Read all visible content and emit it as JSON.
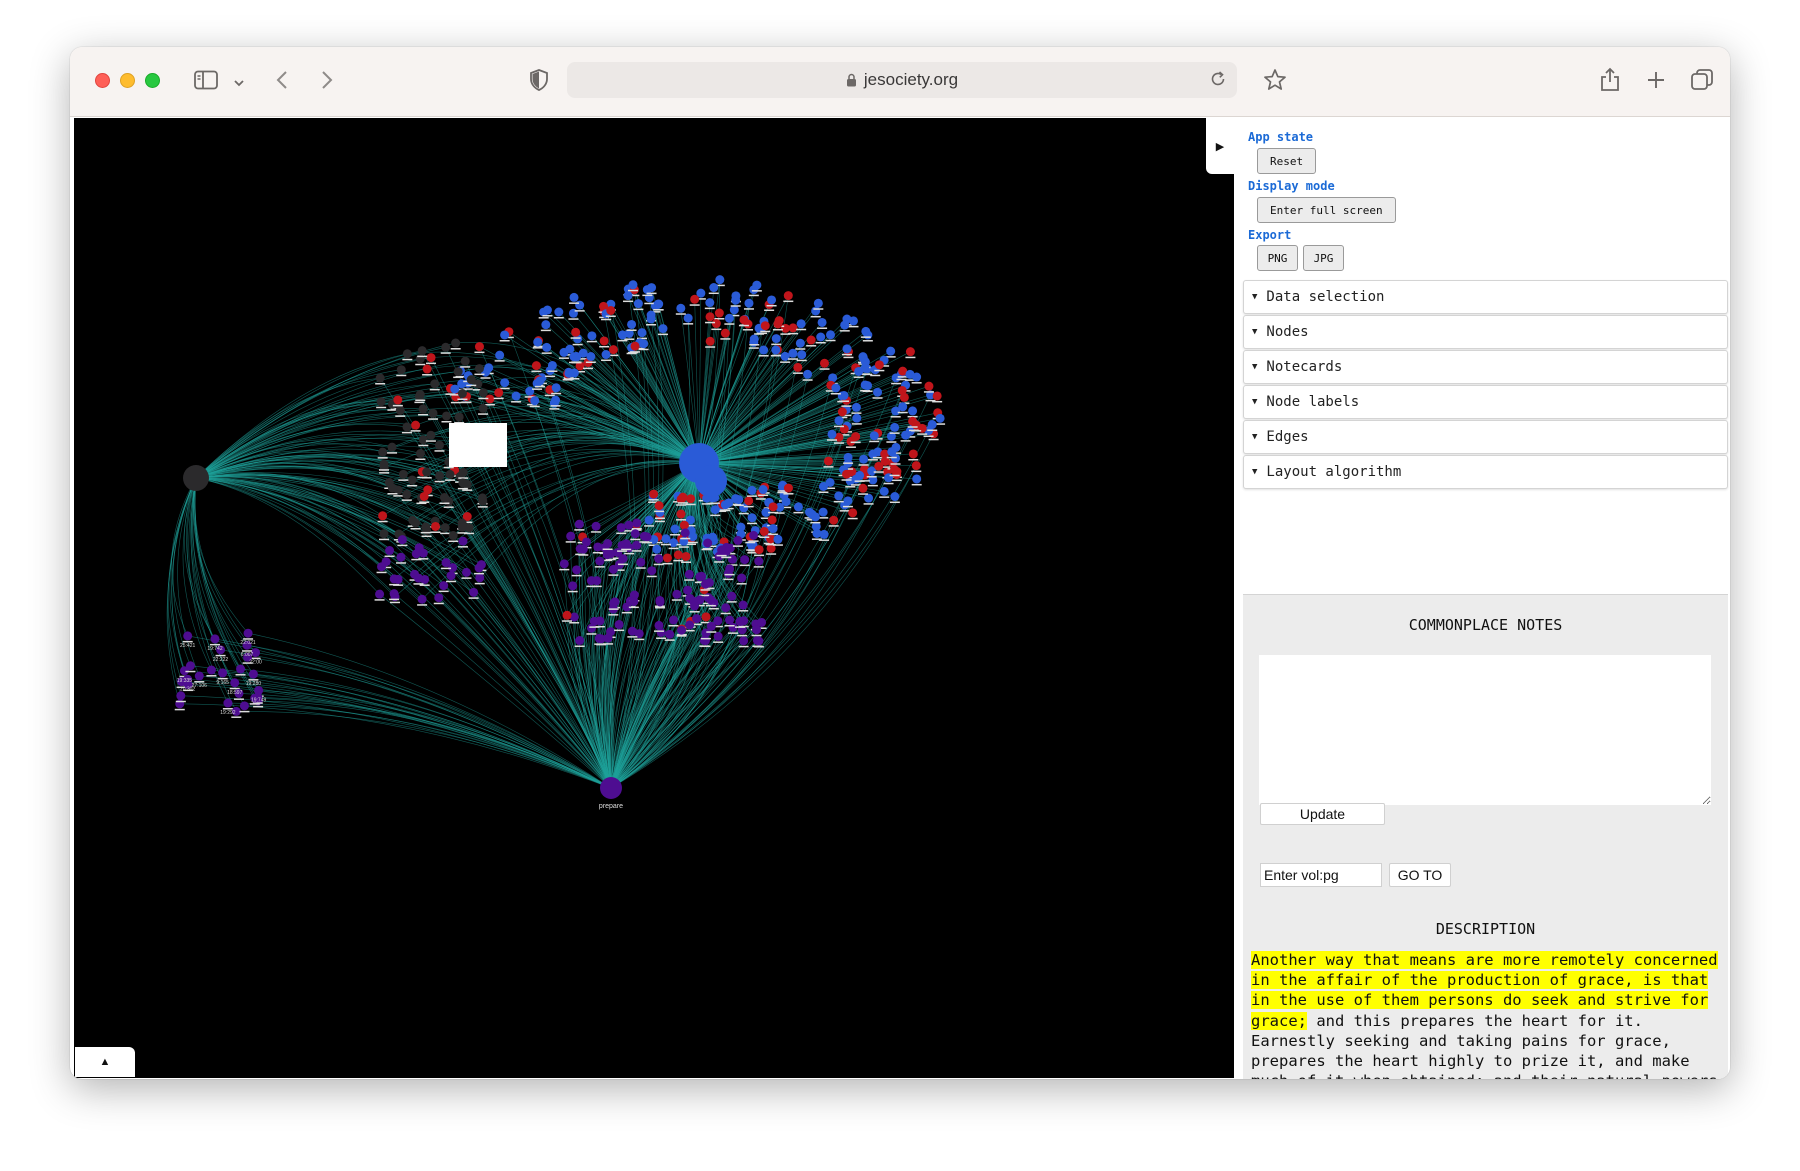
{
  "browser": {
    "url": "jesociety.org"
  },
  "controls": {
    "app_state_label": "App state",
    "reset_label": "Reset",
    "display_mode_label": "Display mode",
    "fullscreen_label": "Enter full screen",
    "export_label": "Export",
    "png_label": "PNG",
    "jpg_label": "JPG"
  },
  "folders": [
    {
      "label": "Data selection"
    },
    {
      "label": "Nodes"
    },
    {
      "label": "Notecards"
    },
    {
      "label": "Node labels"
    },
    {
      "label": "Edges"
    },
    {
      "label": "Layout algorithm"
    }
  ],
  "notes": {
    "title": "COMMONPLACE NOTES",
    "update_label": "Update",
    "volpg_placeholder": "Enter vol:pg",
    "goto_label": "GO TO"
  },
  "description": {
    "title": "DESCRIPTION",
    "highlighted": "Another way that means are more remotely concerned in the affair of the production of grace, is that in the use of them persons do seek and strive for grace;",
    "rest": " and this prepares the heart for it. Earnestly seeking and taking pains for grace, prepares the heart highly to prize it, and make much of it when obtained; and their natural powers and principles are hereby already awakened, and got into such a way"
  },
  "graph": {
    "hub_labels": [
      "prepare"
    ],
    "cluster_labels": [
      "19:280",
      "19:335",
      "22:00",
      "19:742",
      "19:292",
      "25:421",
      "22:021",
      "9:165",
      "20:302",
      "22:222",
      "18:597",
      "6:007",
      "19:749",
      "27:106"
    ],
    "colors": {
      "edge": "#1fa39a",
      "blue_node": "#2a5bd7",
      "red_node": "#c0151b",
      "purple_node": "#4e0d91",
      "dark_node": "#2b2a2c"
    }
  }
}
